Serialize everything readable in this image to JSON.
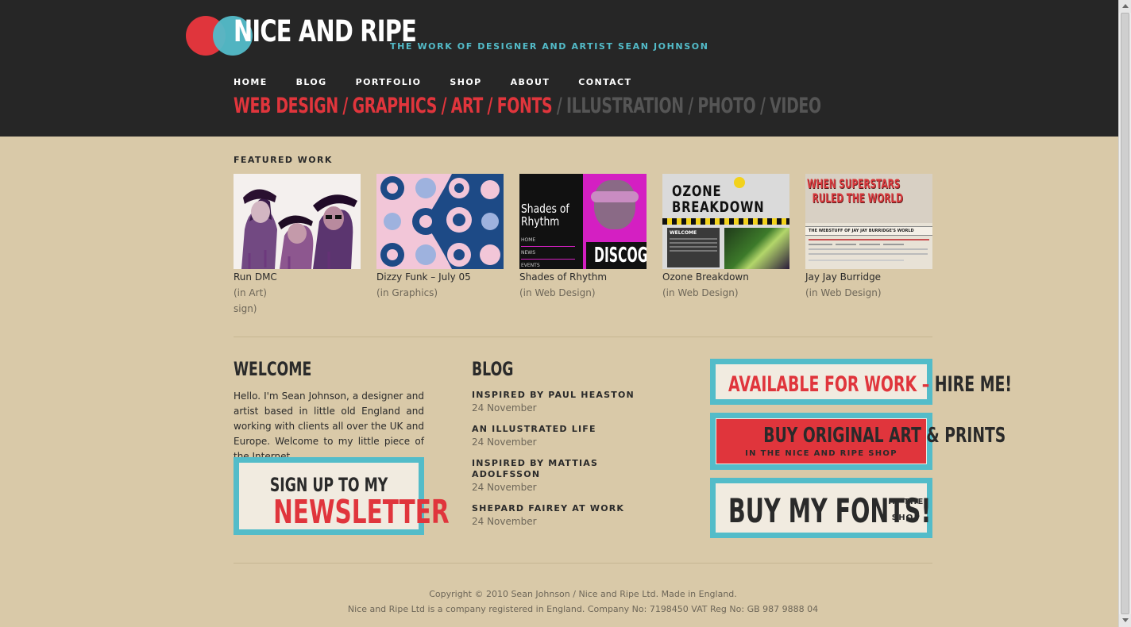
{
  "header": {
    "logo_text": "NICE AND RIPE",
    "tagline": "THE WORK OF DESIGNER AND ARTIST SEAN JOHNSON",
    "nav": [
      "HOME",
      "BLOG",
      "PORTFOLIO",
      "SHOP",
      "ABOUT",
      "CONTACT"
    ],
    "categories_active": [
      "WEB DESIGN",
      "GRAPHICS",
      "ART",
      "FONTS"
    ],
    "categories_inactive": [
      "ILLUSTRATION",
      "PHOTO",
      "VIDEO"
    ],
    "separator": "/"
  },
  "featured": {
    "heading": "FEATURED WORK",
    "items": [
      {
        "title": "Run DMC",
        "category": "(in Art)",
        "extra": "sign)"
      },
      {
        "title": "Dizzy Funk – July 05",
        "category": "(in Graphics)"
      },
      {
        "title": "Shades of Rhythm",
        "category": "(in Web Design)"
      },
      {
        "title": "Ozone Breakdown",
        "category": "(in Web Design)"
      },
      {
        "title": "Jay Jay Burridge",
        "category": "(in Web Design)"
      }
    ],
    "thumb_text": {
      "shades_title_1": "Shades of",
      "shades_title_2": "Rhythm",
      "shades_menu": [
        "HOME",
        "NEWS",
        "EVENTS"
      ],
      "shades_disco": "DISCOG",
      "ozone_title_1": "OZONE",
      "ozone_title_2": "BREAKDOWN",
      "ozone_welcome": "WELCOME",
      "jay_title_1": "WHEN SUPERSTARS",
      "jay_title_2": "RULED THE WORLD",
      "jay_sub": "THE WEBSTUFF OF JAY JAY BURRIDGE'S WORLD"
    }
  },
  "welcome": {
    "heading": "WELCOME",
    "text": "Hello. I'm Sean Johnson, a designer and artist based in little old England and working with clients all over the UK and Europe. Welcome to my little piece of the Internet."
  },
  "newsletter": {
    "line1": "SIGN UP TO MY",
    "line2": "NEWSLETTER"
  },
  "blog": {
    "heading": "BLOG",
    "posts": [
      {
        "title": "INSPIRED BY PAUL HEASTON",
        "date": "24 November"
      },
      {
        "title": "AN ILLUSTRATED LIFE",
        "date": "24 November"
      },
      {
        "title": "INSPIRED BY MATTIAS ADOLFSSON",
        "date": "24 November"
      },
      {
        "title": "SHEPARD FAIREY AT WORK",
        "date": "24 November"
      }
    ]
  },
  "promos": {
    "hire_red": "AVAILABLE FOR WORK",
    "hire_dash": " – ",
    "hire_dark": "HIRE ME!",
    "art_main": "BUY ORIGINAL ART & PRINTS",
    "art_sub": "IN THE NICE AND RIPE SHOP",
    "fonts_main": "BUY MY FONTS!",
    "fonts_sub_1": "IN THE",
    "fonts_sub_2": "SHOP"
  },
  "footer": {
    "copyright": "Copyright © 2010 Sean Johnson / Nice and Ripe Ltd. Made in England.",
    "company": "Nice and Ripe Ltd is a company registered in England. Company No: 7198450 VAT Reg No: GB 987 9888 04"
  },
  "colors": {
    "header_bg": "#262626",
    "page_bg": "#d9c9a8",
    "accent_red": "#e0353c",
    "accent_blue": "#53bcc9",
    "promo_bg": "#f1ebe0"
  }
}
